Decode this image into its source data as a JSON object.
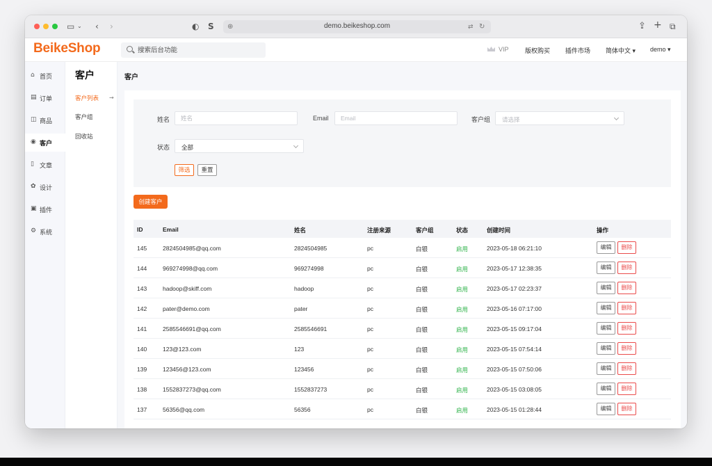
{
  "browser": {
    "url": "demo.beikeshop.com"
  },
  "header": {
    "logo": "BeikeShop",
    "search_placeholder": "搜索后台功能",
    "vip": "VIP",
    "nav": [
      "版权购买",
      "插件市场",
      "简体中文 ▾",
      "demo ▾"
    ]
  },
  "sidebar": {
    "items": [
      {
        "label": "首页",
        "icon": "home-icon"
      },
      {
        "label": "订单",
        "icon": "order-icon"
      },
      {
        "label": "商品",
        "icon": "product-icon"
      },
      {
        "label": "客户",
        "icon": "customer-icon"
      },
      {
        "label": "文章",
        "icon": "article-icon"
      },
      {
        "label": "设计",
        "icon": "design-icon"
      },
      {
        "label": "插件",
        "icon": "plugin-icon"
      },
      {
        "label": "系统",
        "icon": "system-icon"
      }
    ]
  },
  "submenu": {
    "title": "客户",
    "items": [
      "客户列表",
      "客户组",
      "回收站"
    ]
  },
  "page": {
    "title": "客户"
  },
  "filter": {
    "name_label": "姓名",
    "name_placeholder": "姓名",
    "email_label": "Email",
    "email_placeholder": "Email",
    "group_label": "客户组",
    "group_placeholder": "请选择",
    "status_label": "状态",
    "status_value": "全部",
    "filter_button": "筛选",
    "reset_button": "重置"
  },
  "create_button": "创建客户",
  "table": {
    "headers": [
      "ID",
      "Email",
      "姓名",
      "注册来源",
      "客户组",
      "状态",
      "创建时间",
      "操作"
    ],
    "edit_label": "编辑",
    "delete_label": "删除",
    "rows": [
      {
        "id": "145",
        "email": "2824504985@qq.com",
        "name": "2824504985",
        "source": "pc",
        "group": "白银",
        "status": "启用",
        "created": "2023-05-18 06:21:10"
      },
      {
        "id": "144",
        "email": "969274998@qq.com",
        "name": "969274998",
        "source": "pc",
        "group": "白银",
        "status": "启用",
        "created": "2023-05-17 12:38:35"
      },
      {
        "id": "143",
        "email": "hadoop@skiff.com",
        "name": "hadoop",
        "source": "pc",
        "group": "白银",
        "status": "启用",
        "created": "2023-05-17 02:23:37"
      },
      {
        "id": "142",
        "email": "pater@demo.com",
        "name": "pater",
        "source": "pc",
        "group": "白银",
        "status": "启用",
        "created": "2023-05-16 07:17:00"
      },
      {
        "id": "141",
        "email": "2585546691@qq.com",
        "name": "2585546691",
        "source": "pc",
        "group": "白银",
        "status": "启用",
        "created": "2023-05-15 09:17:04"
      },
      {
        "id": "140",
        "email": "123@123.com",
        "name": "123",
        "source": "pc",
        "group": "白银",
        "status": "启用",
        "created": "2023-05-15 07:54:14"
      },
      {
        "id": "139",
        "email": "123456@123.com",
        "name": "123456",
        "source": "pc",
        "group": "白银",
        "status": "启用",
        "created": "2023-05-15 07:50:06"
      },
      {
        "id": "138",
        "email": "1552837273@qq.com",
        "name": "1552837273",
        "source": "pc",
        "group": "白银",
        "status": "启用",
        "created": "2023-05-15 03:08:05"
      },
      {
        "id": "137",
        "email": "56356@qq.com",
        "name": "56356",
        "source": "pc",
        "group": "白银",
        "status": "启用",
        "created": "2023-05-15 01:28:44"
      }
    ]
  },
  "colors": {
    "accent": "#f36a1c",
    "enabled": "#2fb34a",
    "danger": "#ea4b4b"
  }
}
